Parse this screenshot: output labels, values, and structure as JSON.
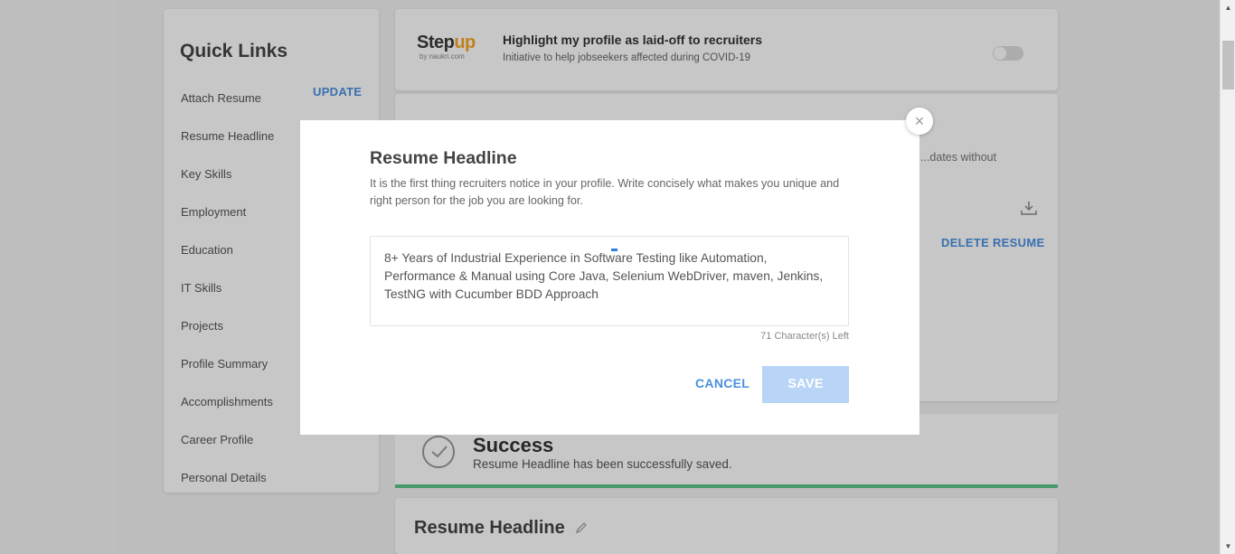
{
  "quick_links": {
    "title": "Quick Links",
    "update_label": "UPDATE",
    "items": [
      "Attach Resume",
      "Resume Headline",
      "Key Skills",
      "Employment",
      "Education",
      "IT Skills",
      "Projects",
      "Profile Summary",
      "Accomplishments",
      "Career Profile",
      "Personal Details"
    ]
  },
  "stepup": {
    "logo_step": "Step",
    "logo_up": "up",
    "logo_by": "by naukri.com",
    "title": "Highlight my profile as laid-off to recruiters",
    "subtitle": "Initiative to help jobseekers affected during COVID-19"
  },
  "resume_card": {
    "side_text": "...dates without",
    "delete_label": "DELETE RESUME"
  },
  "success": {
    "title": "Success",
    "message": "Resume Headline has been successfully saved."
  },
  "resume_headline_card": {
    "title": "Resume Headline"
  },
  "modal": {
    "title": "Resume Headline",
    "description": "It is the first thing recruiters notice in your profile. Write concisely what makes you unique and right person for the job you are looking for.",
    "textarea_value": "8+ Years of Industrial Experience in Software Testing like Automation, Performance & Manual using Core Java, Selenium WebDriver, maven, Jenkins, TestNG with Cucumber BDD Approach",
    "chars_left": "71 Character(s) Left",
    "cancel_label": "CANCEL",
    "save_label": "SAVE",
    "close_glyph": "×"
  },
  "colors": {
    "accent": "#4a90e2",
    "save_disabled": "#b8d4f6",
    "success_bar": "#5cc58b"
  },
  "icons": [
    "close-icon",
    "download-icon",
    "check-circle-icon",
    "edit-pencil-icon",
    "scroll-up-arrow-icon",
    "scroll-down-arrow-icon"
  ]
}
